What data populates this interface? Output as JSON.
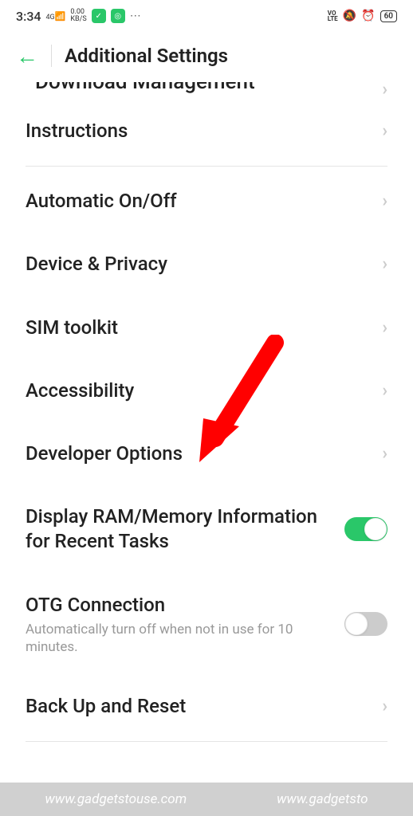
{
  "statusBar": {
    "time": "3:34",
    "signal": "4G",
    "speed": "0.00",
    "speedUnit": "KB/S",
    "volte": "VO\nLTE",
    "battery": "60"
  },
  "header": {
    "title": "Additional Settings"
  },
  "partialItem": {
    "label": "Download Management"
  },
  "items": [
    {
      "label": "Instructions",
      "type": "chevron"
    }
  ],
  "section2": [
    {
      "label": "Automatic On/Off",
      "type": "chevron"
    },
    {
      "label": "Device & Privacy",
      "type": "chevron"
    },
    {
      "label": "SIM toolkit",
      "type": "chevron"
    },
    {
      "label": "Accessibility",
      "type": "chevron"
    },
    {
      "label": "Developer Options",
      "type": "chevron"
    },
    {
      "label": "Display RAM/Memory Information for Recent Tasks",
      "type": "toggle",
      "on": true
    },
    {
      "label": "OTG Connection",
      "sublabel": "Automatically turn off when not in use for 10 minutes.",
      "type": "toggle",
      "on": false
    },
    {
      "label": "Back Up and Reset",
      "type": "chevron"
    }
  ],
  "watermark": {
    "text1": "www.gadgetstouse.com",
    "text2": "www.gadgetsto"
  }
}
